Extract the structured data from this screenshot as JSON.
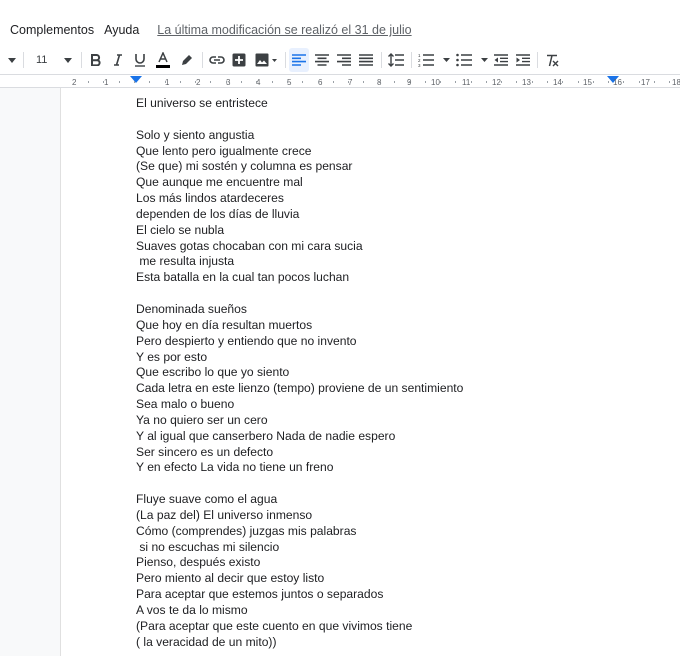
{
  "menubar": {
    "items": [
      "Complementos",
      "Ayuda"
    ],
    "last_edit": "La última modificación se realizó el 31 de julio"
  },
  "toolbar": {
    "font_size": "11"
  },
  "ruler": {
    "ticks": [
      "2",
      "1",
      "1",
      "2",
      "3",
      "4",
      "5",
      "6",
      "7",
      "8",
      "9",
      "10",
      "11",
      "12",
      "13",
      "14",
      "15",
      "16",
      "17",
      "18"
    ]
  },
  "document": {
    "lines": [
      "El universo se entristece",
      "",
      "Solo y siento angustia",
      "Que lento pero igualmente crece",
      "(Se que) mi sostén y columna es pensar",
      "Que aunque me encuentre mal",
      "Los más lindos atardeceres",
      "dependen de los días de lluvia",
      "El cielo se nubla",
      "Suaves gotas chocaban con mi cara sucia",
      " me resulta injusta",
      "Esta batalla en la cual tan pocos luchan",
      "",
      "Denominada sueños",
      "Que hoy en día resultan muertos",
      "Pero despierto y entiendo que no invento",
      "Y es por esto",
      "Que escribo lo que yo siento",
      "Cada letra en este lienzo (tempo) proviene de un sentimiento",
      "Sea malo o bueno",
      "Ya no quiero ser un cero",
      "Y al igual que canserbero Nada de nadie espero",
      "Ser sincero es un defecto",
      "Y en efecto La vida no tiene un freno",
      "",
      "Fluye suave como el agua",
      "(La paz del) El universo inmenso",
      "Cómo (comprendes) juzgas mis palabras",
      " si no escuchas mi silencio",
      "Pienso, después existo",
      "Pero miento al decir que estoy listo",
      "Para aceptar que estemos juntos o separados",
      "A vos te da lo mismo",
      "(Para aceptar que este cuento en que vivimos tiene",
      "( la veracidad de un mito))"
    ]
  }
}
